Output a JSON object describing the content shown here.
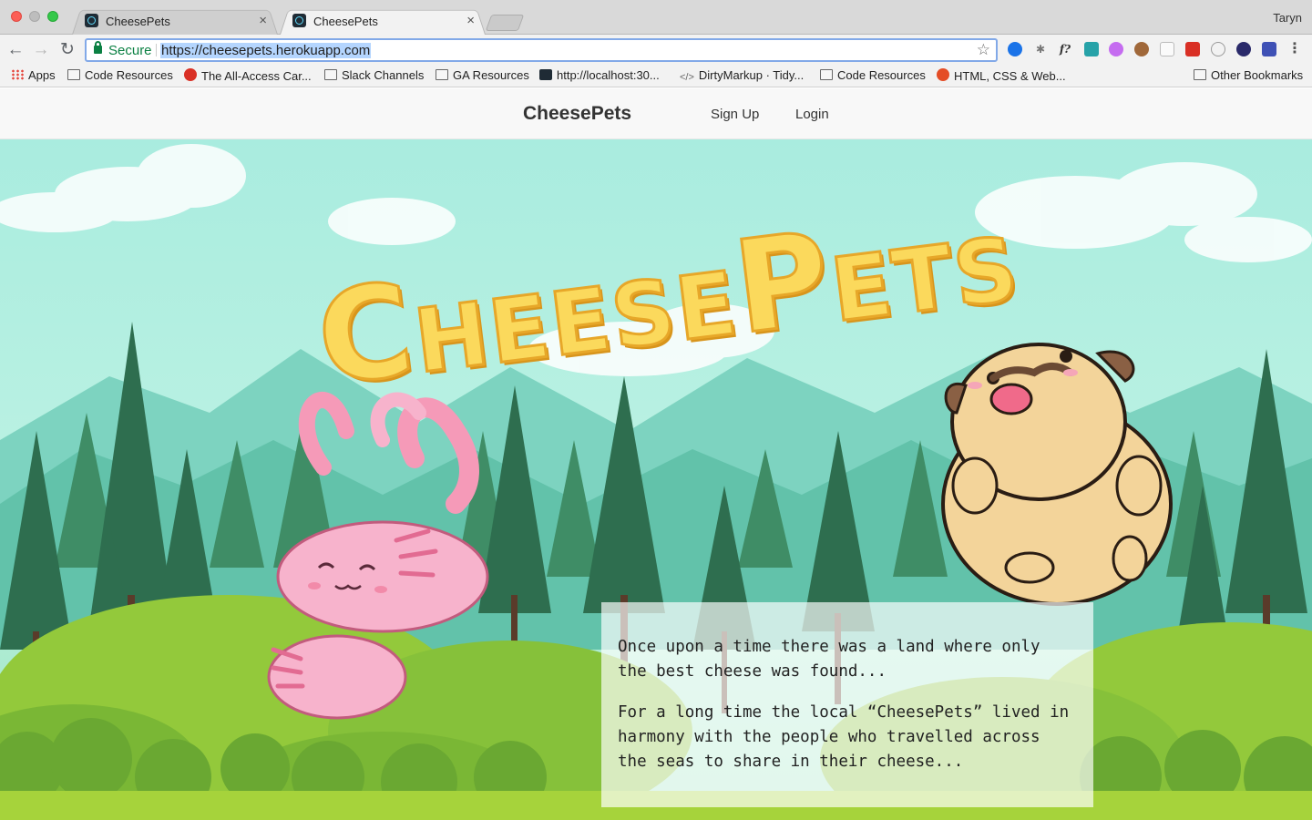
{
  "browser": {
    "tabs": [
      {
        "title": "CheesePets",
        "active": false
      },
      {
        "title": "CheesePets",
        "active": true
      }
    ],
    "profile_name": "Taryn",
    "security_label": "Secure",
    "url": "https://cheesepets.herokuapp.com",
    "close_glyph": "×",
    "bookmarks": [
      {
        "label": "Apps",
        "icon": "apps-grid-icon"
      },
      {
        "label": "Code Resources",
        "icon": "folder-icon"
      },
      {
        "label": "The All-Access Car...",
        "icon": "site-favicon"
      },
      {
        "label": "Slack Channels",
        "icon": "folder-icon"
      },
      {
        "label": "GA Resources",
        "icon": "folder-icon"
      },
      {
        "label": "http://localhost:30...",
        "icon": "react-favicon"
      },
      {
        "label": "DirtyMarkup · Tidy...",
        "icon": "code-icon"
      },
      {
        "label": "Code Resources",
        "icon": "folder-icon"
      },
      {
        "label": "HTML, CSS & Web...",
        "icon": "html5-icon"
      },
      {
        "label": "Other Bookmarks",
        "icon": "folder-icon"
      }
    ],
    "extension_icons": [
      "messenger-icon",
      "bug-icon",
      "font-icon",
      "eyedropper-icon",
      "color-icon",
      "avatar-icon",
      "window-icon",
      "adblock-icon",
      "info-icon",
      "planet-icon",
      "bookmark-icon",
      "menu-icon"
    ]
  },
  "site": {
    "brand": "CheesePets",
    "nav": {
      "signup": "Sign Up",
      "login": "Login"
    },
    "logo_text_parts": [
      "C",
      "HEESE",
      "P",
      "ETS"
    ],
    "story": [
      "Once upon a time there was a land where only the best cheese was found...",
      "For a long time the local “CheesePets” lived in harmony with the people who travelled across the seas to share in their cheese..."
    ]
  },
  "colors": {
    "sky": "#b2efe0",
    "grass": "#a6d33b",
    "tree_dark": "#2e6e4f",
    "cheese": "#fbd95c",
    "axolotl": "#f7b3cc",
    "pug": "#f3d49a"
  }
}
